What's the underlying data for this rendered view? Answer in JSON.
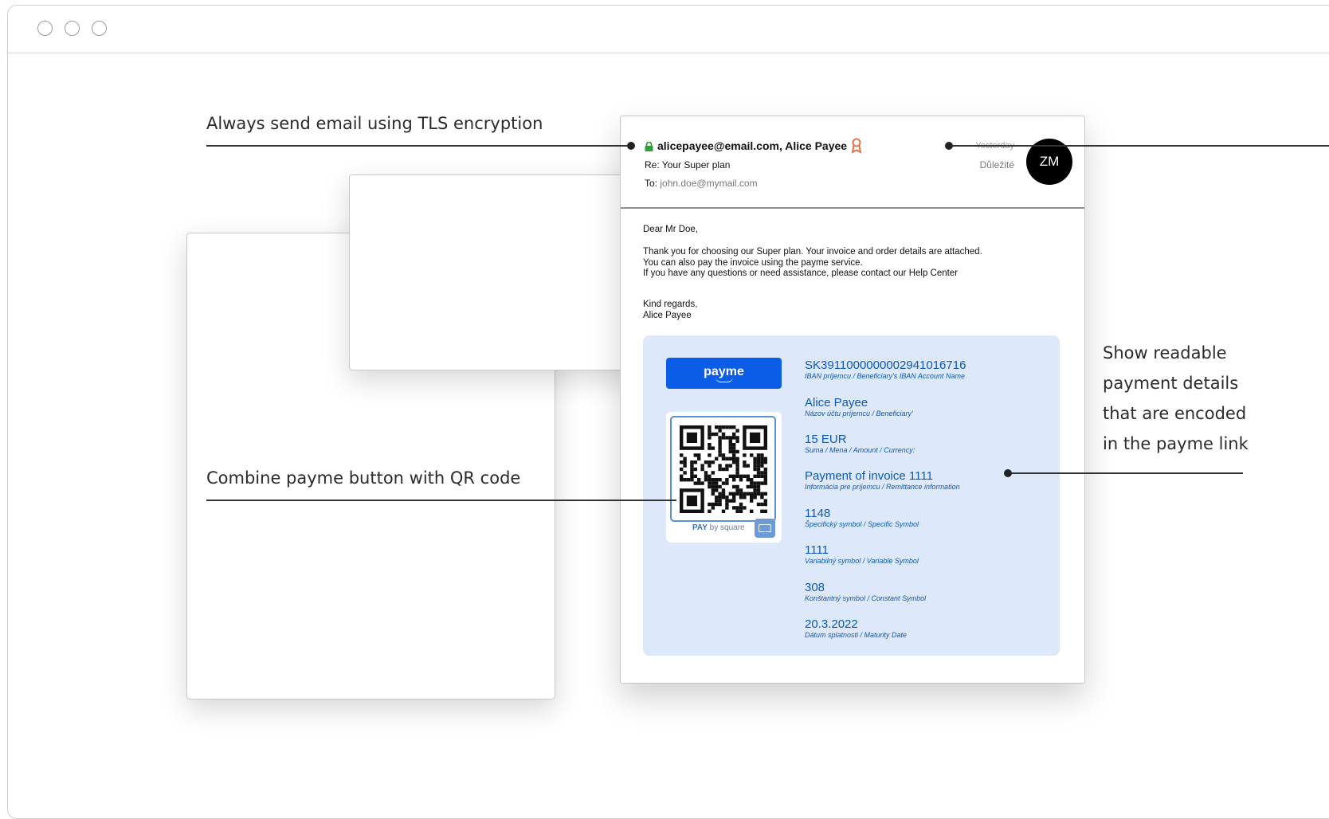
{
  "callouts": {
    "tls": "Always send email using TLS encryption",
    "combine": "Combine payme button with QR code",
    "readable": [
      "Show readable",
      "payment details",
      "that are encoded",
      "in the payme link"
    ]
  },
  "email": {
    "sender": "alicepayee@email.com, Alice Payee",
    "subject": "Re: Your Super plan",
    "to_label": "To:",
    "to_address": "john.doe@mymail.com",
    "date": "Yesterday",
    "label": "Důležité",
    "avatar_initials": "ZM",
    "greeting": "Dear Mr Doe,",
    "paragraph": [
      "Thank you for choosing our Super plan. Your invoice and order details are attached.",
      "You can also pay the invoice using the payme service.",
      "If you have any questions or need assistance, please contact our Help Center"
    ],
    "signoff": [
      "Kind regards,",
      "Alice Payee"
    ]
  },
  "payment": {
    "button_label": "payme",
    "qr_caption_bold": "PAY",
    "qr_caption_rest": " by square",
    "details": [
      {
        "value": "SK3911000000002941016716",
        "label": "IBAN príjemcu / Beneficiary's IBAN Account Name"
      },
      {
        "value": "Alice Payee",
        "label": "Názov účtu príjemcu / Beneficiary'"
      },
      {
        "value": "15 EUR",
        "label": "Suma / Mena / Amount / Currency:"
      },
      {
        "value": "Payment of invoice 1111",
        "label": "Informácia pre príjemcu / Remittance information"
      },
      {
        "value": "1148",
        "label": "Špecifický symbol / Specific Symbol"
      },
      {
        "value": "1111",
        "label": "Variabilný symbol / Variable Symbol"
      },
      {
        "value": "308",
        "label": "Konštantný symbol / Constant Symbol"
      },
      {
        "value": "20.3.2022",
        "label": "Dátum splatnosti / Maturity Date"
      }
    ]
  },
  "colors": {
    "payme_blue": "#0b5ce6",
    "panel_bg": "#dde8fb",
    "lock_green": "#2e9e3a",
    "badge_orange": "#e2734a"
  }
}
